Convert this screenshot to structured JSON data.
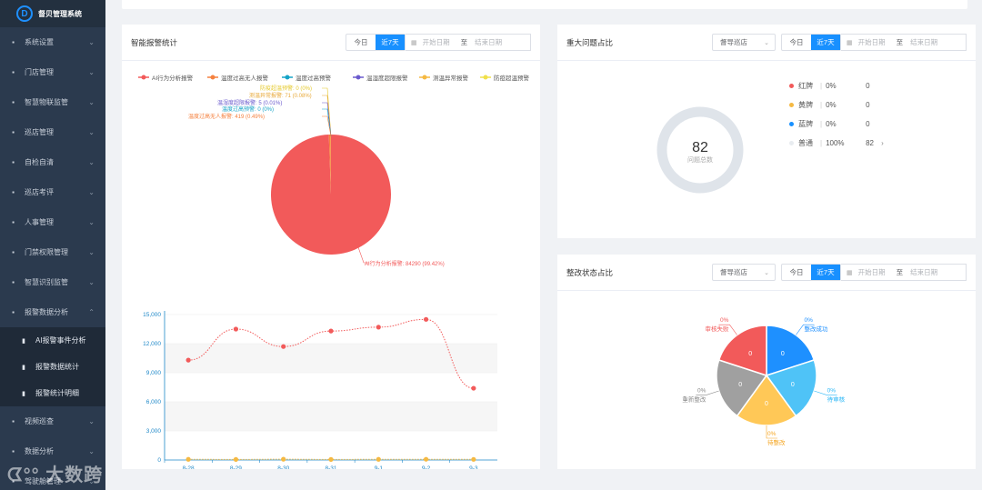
{
  "app": {
    "brand": "督贝管理系统"
  },
  "sidebar": {
    "items": [
      {
        "label": "系统设置",
        "icon": "user-gear-icon"
      },
      {
        "label": "门店管理",
        "icon": "store-icon"
      },
      {
        "label": "智慧物联监管",
        "icon": "iot-icon"
      },
      {
        "label": "巡店管理",
        "icon": "grid-icon"
      },
      {
        "label": "自检自清",
        "icon": "checklist-icon"
      },
      {
        "label": "巡店考评",
        "icon": "evaluation-icon"
      },
      {
        "label": "人事管理",
        "icon": "people-icon"
      },
      {
        "label": "门禁权限管理",
        "icon": "door-icon"
      },
      {
        "label": "智慧识别监管",
        "icon": "recognition-icon"
      },
      {
        "label": "报警数据分析",
        "icon": "alarm-data-icon"
      }
    ],
    "sub_items": [
      {
        "label": "AI报警事件分析",
        "icon": "document-icon"
      },
      {
        "label": "报警数据统计",
        "icon": "book-icon"
      },
      {
        "label": "报警统计明细",
        "icon": "book-icon"
      }
    ],
    "bottom_items": [
      {
        "label": "视频巡查",
        "icon": "video-icon"
      },
      {
        "label": "数据分析",
        "icon": "analysis-icon"
      },
      {
        "label": "驾驶舱管理",
        "icon": "cockpit-icon"
      }
    ],
    "watermark": "大数跨境"
  },
  "filters": {
    "today": "今日",
    "week": "近7天",
    "start_placeholder": "开始日期",
    "to": "至",
    "end_placeholder": "结束日期",
    "store_placeholder": "督导巡店"
  },
  "alarm_panel": {
    "title": "智能报警统计",
    "legend": [
      {
        "name": "AI行为分析报警",
        "color": "#f25a5a"
      },
      {
        "name": "温度过高无人报警",
        "color": "#f5813f"
      },
      {
        "name": "温度过高预警",
        "color": "#15a3c7"
      },
      {
        "name": "温湿度超限报警",
        "color": "#6a5acd"
      },
      {
        "name": "测温异常报警",
        "color": "#f5b942"
      },
      {
        "name": "防疫超温预警",
        "color": "#f0e04a"
      }
    ],
    "pie_labels": [
      {
        "text": "防疫超温预警: 0 (0%)",
        "color": "#e5c92b"
      },
      {
        "text": "测温异常报警: 71 (0.08%)",
        "color": "#e8a93a"
      },
      {
        "text": "温湿度超限报警: 5 (0.01%)",
        "color": "#6a5acd"
      },
      {
        "text": "温度过高预警: 0 (0%)",
        "color": "#15a3c7"
      },
      {
        "text": "温度过高无人报警: 419 (0.49%)",
        "color": "#f5813f"
      },
      {
        "text": "AI行为分析报警: 84290 (99.42%)",
        "color": "#f25a5a"
      }
    ]
  },
  "chart_data": [
    {
      "type": "pie",
      "labels": [
        "AI行为分析报警",
        "温度过高无人报警",
        "温度过高预警",
        "温湿度超限报警",
        "测温异常报警",
        "防疫超温预警"
      ],
      "values": [
        84290,
        419,
        0,
        5,
        71,
        0
      ],
      "percents": [
        "99.42%",
        "0.49%",
        "0%",
        "0.01%",
        "0.08%",
        "0%"
      ],
      "colors": [
        "#f25a5a",
        "#f5813f",
        "#15a3c7",
        "#6a5acd",
        "#f5b942",
        "#f0e04a"
      ]
    },
    {
      "type": "line",
      "categories": [
        "8-28",
        "8-29",
        "8-30",
        "8-31",
        "9-1",
        "9-2",
        "9-3"
      ],
      "y_ticks": [
        "0",
        "3,000",
        "6,000",
        "9,000",
        "12,000",
        "15,000"
      ],
      "ylim": [
        0,
        15000
      ],
      "series": [
        {
          "color": "#f25a5a",
          "values": [
            10300,
            13500,
            11700,
            13300,
            13700,
            14500,
            7400
          ]
        },
        {
          "color": "#f5b942",
          "values": [
            70,
            60,
            80,
            60,
            70,
            75,
            65
          ]
        }
      ],
      "grid": true
    },
    {
      "type": "donut",
      "center_value": "82",
      "center_label": "问题总数",
      "values": [
        0,
        0,
        0,
        82
      ],
      "colors": [
        "#f25a5a",
        "#f5b942",
        "#1890ff",
        "#dfe4ea"
      ]
    },
    {
      "type": "pie",
      "labels": [
        "整改成功",
        "待审核",
        "待整改",
        "重新整改",
        "审核失败"
      ],
      "values": [
        1,
        1,
        1,
        1,
        1
      ],
      "slice_values": [
        "0",
        "0",
        "0",
        "0",
        "0"
      ],
      "percents": [
        "0%",
        "0%",
        "0%",
        "0%",
        "0%"
      ],
      "colors": [
        "#1e90ff",
        "#4fc3f7",
        "#ffc857",
        "#a0a0a0",
        "#f25a5a"
      ]
    }
  ],
  "issue_panel": {
    "title": "重大问题占比",
    "rows": [
      {
        "name": "红牌",
        "pct": "0%",
        "count": "0",
        "color": "#f25a5a"
      },
      {
        "name": "黄牌",
        "pct": "0%",
        "count": "0",
        "color": "#f5b942"
      },
      {
        "name": "蓝牌",
        "pct": "0%",
        "count": "0",
        "color": "#1890ff"
      },
      {
        "name": "普通",
        "pct": "100%",
        "count": "82",
        "color": "#e8ecf0",
        "arrow": "›"
      }
    ]
  },
  "rect_panel": {
    "title": "整改状态占比",
    "labels": [
      {
        "pct": "0%",
        "name": "整改成功",
        "color": "#1e90ff"
      },
      {
        "pct": "0%",
        "name": "待审核",
        "color": "#29b6f6"
      },
      {
        "pct": "0%",
        "name": "待整改",
        "color": "#f5a623"
      },
      {
        "pct": "0%",
        "name": "重新整改",
        "color": "#888888"
      },
      {
        "pct": "0%",
        "name": "审核失败",
        "color": "#f25a5a"
      }
    ]
  }
}
